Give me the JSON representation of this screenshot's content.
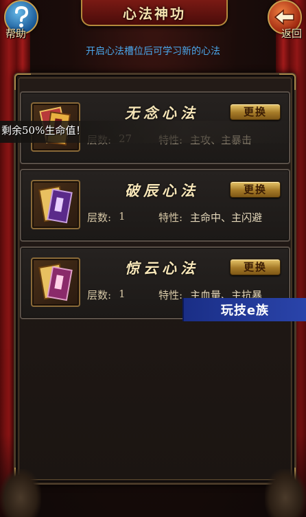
{
  "header": {
    "title": "心法神功",
    "help_label": "帮助",
    "back_label": "返回",
    "help_icon": "question-mark-icon",
    "back_icon": "back-arrow-icon"
  },
  "subtitle": "开启心法槽位后可学习新的心法",
  "skills": [
    {
      "name": "无念心法",
      "swap_label": "更换",
      "layer_label": "层数:",
      "layer_value": "27",
      "trait_label": "特性:",
      "trait_value": "主攻、主暴击"
    },
    {
      "name": "破辰心法",
      "swap_label": "更换",
      "layer_label": "层数:",
      "layer_value": "1",
      "trait_label": "特性:",
      "trait_value": "主命中、主闪避"
    },
    {
      "name": "惊云心法",
      "swap_label": "更换",
      "layer_label": "层数:",
      "layer_value": "1",
      "trait_label": "特性:",
      "trait_value": "主血量、主抗暴"
    }
  ],
  "toast": "剩余50%生命值！",
  "watermark": "玩技e族",
  "colors": {
    "accent_gold": "#e8c66a",
    "subtitle_blue": "#4aa6ea",
    "curtain_red": "#a01818"
  }
}
